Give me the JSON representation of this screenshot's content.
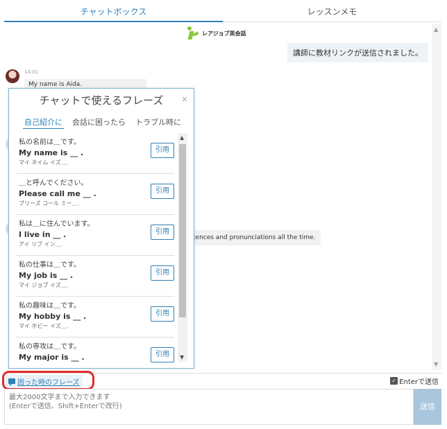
{
  "tabs": [
    {
      "label": "チャットボックス"
    },
    {
      "label": "レッスンメモ"
    }
  ],
  "chat": {
    "logo_text": "レアジョブ英会話",
    "system_message": "講師に教材リンクが送信されました。",
    "messages": [
      {
        "time": "14:01",
        "text": "My name is Aida."
      },
      {
        "time": "",
        "text": "tences and pronunciations all the time."
      }
    ]
  },
  "popup": {
    "title": "チャットで使えるフレーズ",
    "close_icon": "×",
    "tabs": [
      {
        "label": "自己紹介に"
      },
      {
        "label": "会話に困ったら"
      },
      {
        "label": "トラブル時に"
      }
    ],
    "quote_label": "引用",
    "phrases": [
      {
        "jp": "私の名前は＿です。",
        "en": "My name is __ .",
        "kana": "マイ ネイム イズ＿."
      },
      {
        "jp": "＿と呼んでください。",
        "en": "Please call me __ .",
        "kana": "プリーズ コール ミー＿."
      },
      {
        "jp": "私は＿に住んでいます。",
        "en": "I live in __ .",
        "kana": "アイ リブ イン＿."
      },
      {
        "jp": "私の仕事は＿です。",
        "en": "My job is __ .",
        "kana": "マイ ジョブ イズ＿."
      },
      {
        "jp": "私の趣味は＿です。",
        "en": "My hobby is __ .",
        "kana": "マイ ホビー イズ＿."
      },
      {
        "jp": "私の専攻は＿です。",
        "en": "My major is __ .",
        "kana": ""
      }
    ]
  },
  "bottom": {
    "phrase_link": "困った時のフレーズ",
    "enter_send_label": "Enterで送信",
    "enter_send_checked": true
  },
  "input": {
    "placeholder": "最大2000文字まで入力できます\n(Enterで送信、Shift+Enterで改行)"
  },
  "send_label": "送信",
  "colors": {
    "accent": "#2d7fb5",
    "highlight": "#e12a2a",
    "send_button": "#a9c6dc",
    "logo": "#8cc63f"
  }
}
